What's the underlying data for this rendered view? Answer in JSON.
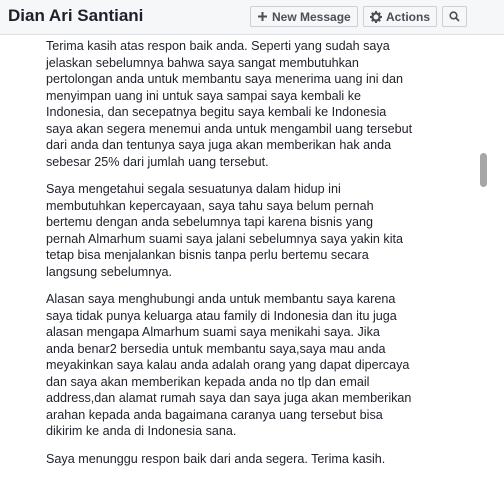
{
  "header": {
    "title": "Dian Ari Santiani",
    "new_message_label": "New Message",
    "actions_label": "Actions",
    "icons": [
      "plus-icon",
      "gear-icon",
      "search-icon"
    ]
  },
  "message": {
    "paragraphs": [
      "Terima kasih atas respon baik anda. Seperti yang sudah saya\njelaskan sebelumnya bahwa saya sangat membutuhkan\npertolongan anda untuk membantu saya menerima uang ini dan\nmenyimpan uang ini untuk saya sampai saya kembali ke\nIndonesia, dan secepatnya begitu saya kembali ke Indonesia\nsaya akan segera menemui anda untuk mengambil uang tersebut\ndari anda dan tentunya saya juga akan memberikan hak anda\nsebesar 25% dari jumlah uang tersebut.",
      "Saya mengetahui segala sesuatunya dalam hidup ini\nmembutuhkan kepercayaan, saya tahu saya belum pernah\nbertemu dengan anda sebelumnya tapi karena bisnis yang\npernah Almarhum suami saya jalani sebelumnya saya yakin kita\ntetap bisa menjalankan bisnis tanpa perlu bertemu secara\nlangsung sebelumnya.",
      "Alasan saya menghubungi anda untuk membantu saya karena\nsaya tidak punya keluarga atau family di Indonesia dan itu juga\nalasan mengapa Almarhum suami saya menikahi saya. Jika\nanda benar2 bersedia untuk membantu saya,saya mau anda\nmeyakinkan saya kalau anda adalah orang yang dapat dipercaya\ndan saya akan memberikan kepada anda no tlp dan email\naddress,dan alamat rumah saya dan saya juga akan memberikan\narahan kepada anda bagaimana caranya uang tersebut bisa\ndikirim ke anda di Indonesia sana.",
      "Saya menunggu respon baik dari anda segera. Terima kasih."
    ]
  },
  "scrollbar": {
    "position": 0.28
  }
}
